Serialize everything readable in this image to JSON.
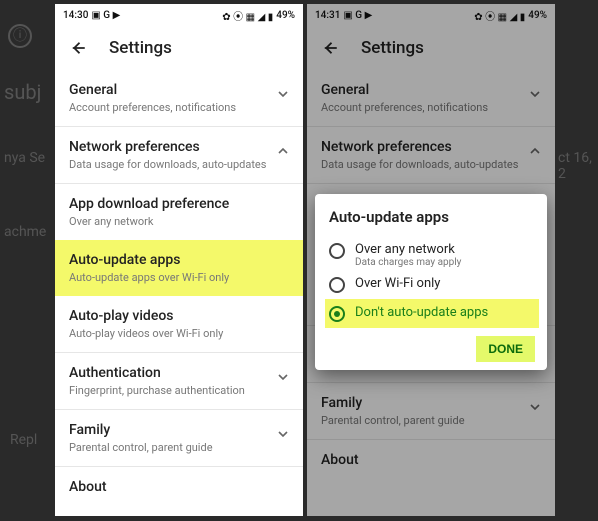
{
  "colors": {
    "highlight": "#f4f96a",
    "done_bg": "#e4f96a",
    "done_fg": "#0b6b0b",
    "radio_sel": "#1a7f1a"
  },
  "bg_page": {
    "info_icon": "ⓘ",
    "subj_label": "subj",
    "sender_frag": "nya Se",
    "attach_frag": "achme",
    "reply_frag": "Repl",
    "date_frag": "ct 16, 2"
  },
  "status": {
    "left_time_a": "14:30",
    "left_time_b": "14:31",
    "left_icons": "▣ G ▶",
    "right_icons": "✿ ⦿ ▦ ◢ ▮",
    "battery": "49%"
  },
  "header": {
    "title": "Settings"
  },
  "sections": {
    "general": {
      "title": "General",
      "sub": "Account preferences, notifications"
    },
    "network": {
      "title": "Network preferences",
      "sub": "Data usage for downloads, auto-updates"
    },
    "appdl": {
      "title": "App download preference",
      "sub": "Over any network"
    },
    "autoupd": {
      "title": "Auto-update apps",
      "sub": "Auto-update apps over Wi-Fi only"
    },
    "autoplay": {
      "title": "Auto-play videos",
      "sub": "Auto-play videos over Wi-Fi only"
    },
    "auth": {
      "title": "Authentication",
      "sub": "Fingerprint, purchase authentication"
    },
    "family": {
      "title": "Family",
      "sub": "Parental control, parent guide"
    },
    "about": {
      "title": "About"
    }
  },
  "dialog": {
    "title": "Auto-update apps",
    "opts": [
      {
        "label": "Over any network",
        "sub": "Data charges may apply",
        "selected": false
      },
      {
        "label": "Over Wi-Fi only",
        "sub": "",
        "selected": false
      },
      {
        "label": "Don't auto-update apps",
        "sub": "",
        "selected": true
      }
    ],
    "done": "DONE"
  }
}
